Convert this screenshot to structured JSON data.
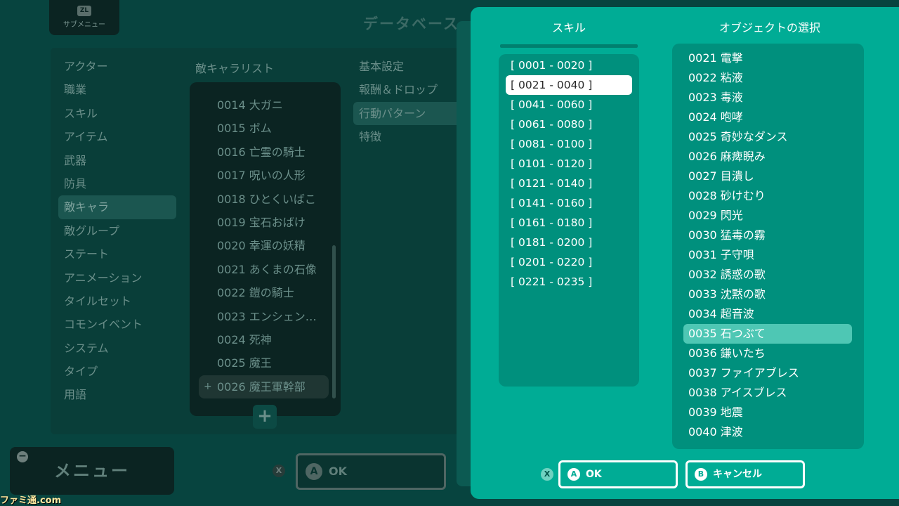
{
  "background": {
    "submenu": {
      "key": "ZL",
      "label": "サブメニュー"
    },
    "title": "データベース",
    "categories": [
      {
        "label": "アクター",
        "selected": false
      },
      {
        "label": "職業",
        "selected": false
      },
      {
        "label": "スキル",
        "selected": false
      },
      {
        "label": "アイテム",
        "selected": false
      },
      {
        "label": "武器",
        "selected": false
      },
      {
        "label": "防具",
        "selected": false
      },
      {
        "label": "敵キャラ",
        "selected": true
      },
      {
        "label": "敵グループ",
        "selected": false
      },
      {
        "label": "ステート",
        "selected": false
      },
      {
        "label": "アニメーション",
        "selected": false
      },
      {
        "label": "タイルセット",
        "selected": false
      },
      {
        "label": "コモンイベント",
        "selected": false
      },
      {
        "label": "システム",
        "selected": false
      },
      {
        "label": "タイプ",
        "selected": false
      },
      {
        "label": "用語",
        "selected": false
      }
    ],
    "enemy_list_title": "敵キャラリスト",
    "enemies": [
      {
        "label": "0014 大ガニ",
        "selected": false
      },
      {
        "label": "0015 ボム",
        "selected": false
      },
      {
        "label": "0016 亡霊の騎士",
        "selected": false
      },
      {
        "label": "0017 呪いの人形",
        "selected": false
      },
      {
        "label": "0018 ひとくいばこ",
        "selected": false
      },
      {
        "label": "0019 宝石おばけ",
        "selected": false
      },
      {
        "label": "0020 幸運の妖精",
        "selected": false
      },
      {
        "label": "0021 あくまの石像",
        "selected": false
      },
      {
        "label": "0022 鎧の騎士",
        "selected": false
      },
      {
        "label": "0023 エンシェン…",
        "selected": false
      },
      {
        "label": "0024 死神",
        "selected": false
      },
      {
        "label": "0025 魔王",
        "selected": false
      },
      {
        "label": "0026 魔王軍幹部",
        "selected": true
      }
    ],
    "selected_marker": "+",
    "add_label": "+",
    "properties": [
      {
        "label": "基本設定",
        "selected": false
      },
      {
        "label": "報酬＆ドロップ",
        "selected": false
      },
      {
        "label": "行動パターン",
        "selected": true
      },
      {
        "label": "特徴",
        "selected": false
      }
    ],
    "menu_icon": "−",
    "menu_label": "メニュー",
    "x_key": "X",
    "ok_key": "A",
    "ok_label": "OK",
    "watermark": "ファミ通.com"
  },
  "dialog": {
    "skill_header": "スキル",
    "object_header": "オブジェクトの選択",
    "ranges": [
      {
        "label": "[ 0001 - 0020 ]",
        "selected": false
      },
      {
        "label": "[ 0021 - 0040 ]",
        "selected": true
      },
      {
        "label": "[ 0041 - 0060 ]",
        "selected": false
      },
      {
        "label": "[ 0061 - 0080 ]",
        "selected": false
      },
      {
        "label": "[ 0081 - 0100 ]",
        "selected": false
      },
      {
        "label": "[ 0101 - 0120 ]",
        "selected": false
      },
      {
        "label": "[ 0121 - 0140 ]",
        "selected": false
      },
      {
        "label": "[ 0141 - 0160 ]",
        "selected": false
      },
      {
        "label": "[ 0161 - 0180 ]",
        "selected": false
      },
      {
        "label": "[ 0181 - 0200 ]",
        "selected": false
      },
      {
        "label": "[ 0201 - 0220 ]",
        "selected": false
      },
      {
        "label": "[ 0221 - 0235 ]",
        "selected": false
      }
    ],
    "objects": [
      {
        "label": "0021 電撃",
        "selected": false
      },
      {
        "label": "0022 粘液",
        "selected": false
      },
      {
        "label": "0023 毒液",
        "selected": false
      },
      {
        "label": "0024 咆哮",
        "selected": false
      },
      {
        "label": "0025 奇妙なダンス",
        "selected": false
      },
      {
        "label": "0026 麻痺睨み",
        "selected": false
      },
      {
        "label": "0027 目潰し",
        "selected": false
      },
      {
        "label": "0028 砂けむり",
        "selected": false
      },
      {
        "label": "0029 閃光",
        "selected": false
      },
      {
        "label": "0030 猛毒の霧",
        "selected": false
      },
      {
        "label": "0031 子守唄",
        "selected": false
      },
      {
        "label": "0032 誘惑の歌",
        "selected": false
      },
      {
        "label": "0033 沈黙の歌",
        "selected": false
      },
      {
        "label": "0034 超音波",
        "selected": false
      },
      {
        "label": "0035 石つぶて",
        "selected": true
      },
      {
        "label": "0036 鎌いたち",
        "selected": false
      },
      {
        "label": "0037 ファイアブレス",
        "selected": false
      },
      {
        "label": "0038 アイスブレス",
        "selected": false
      },
      {
        "label": "0039 地震",
        "selected": false
      },
      {
        "label": "0040 津波",
        "selected": false
      }
    ],
    "x_key": "X",
    "ok_key": "A",
    "ok_label": "OK",
    "cancel_key": "B",
    "cancel_label": "キャンセル"
  }
}
